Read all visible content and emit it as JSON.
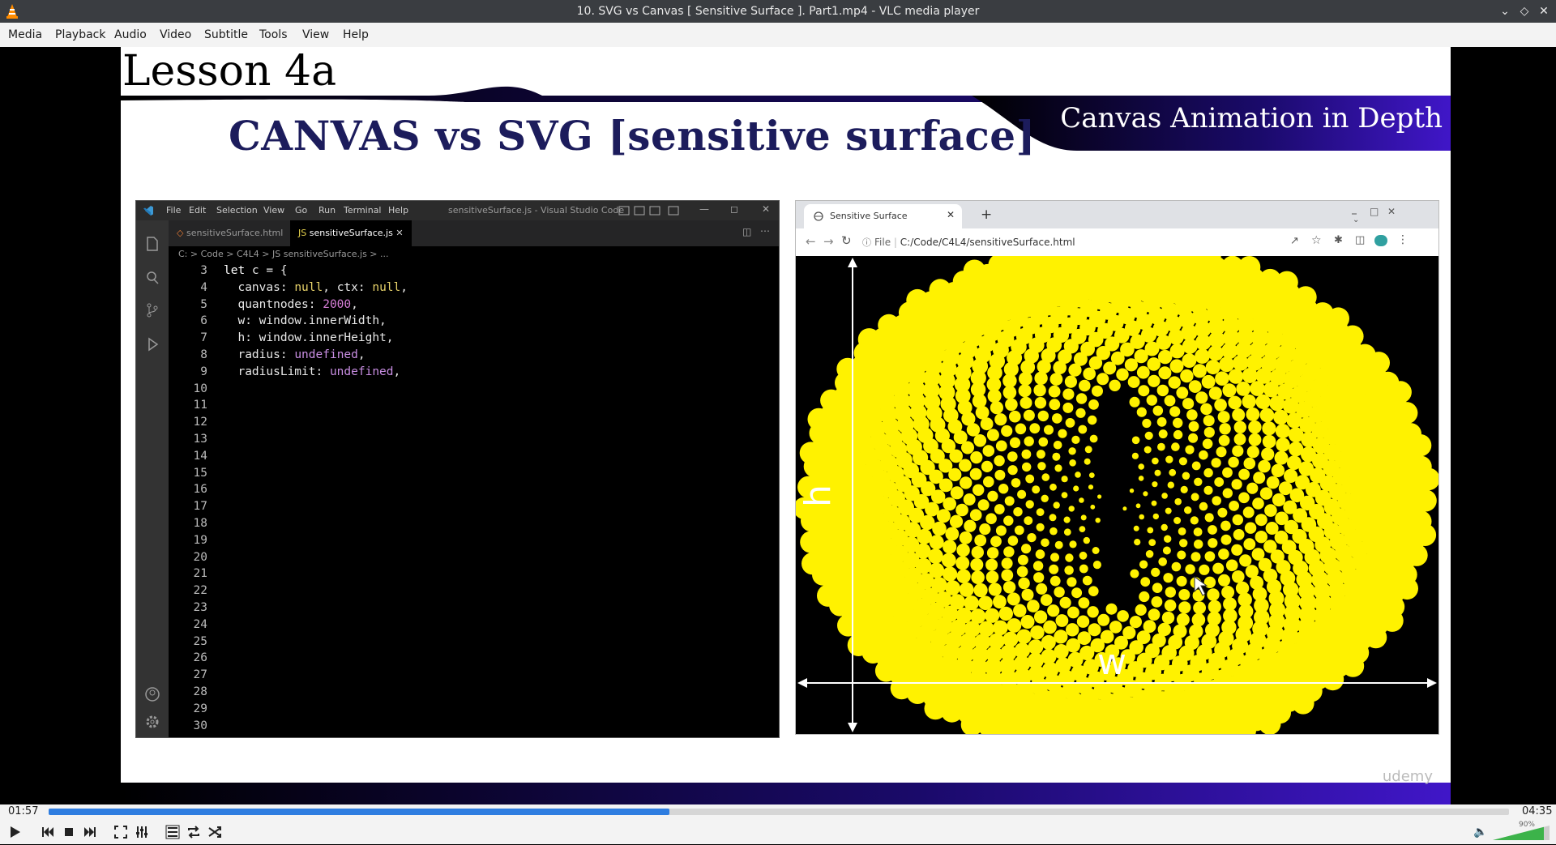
{
  "window": {
    "title": "10. SVG vs Canvas [ Sensitive Surface ]. Part1.mp4 - VLC media player"
  },
  "menu": [
    "Media",
    "Playback",
    "Audio",
    "Video",
    "Subtitle",
    "Tools",
    "View",
    "Help"
  ],
  "slide": {
    "lesson": "Lesson 4a",
    "course": "Canvas Animation in Depth",
    "heading": "CANVAS vs SVG [sensitive surface]",
    "watermark": "udemy"
  },
  "vscode": {
    "menu": [
      "File",
      "Edit",
      "Selection",
      "View",
      "Go",
      "Run",
      "Terminal",
      "Help"
    ],
    "title": "sensitiveSurface.js - Visual Studio Code",
    "tabs": [
      {
        "label": "sensitiveSurface.html",
        "active": false
      },
      {
        "label": "sensitiveSurface.js",
        "active": true
      }
    ],
    "breadcrumb": "C: > Code > C4L4 > JS sensitiveSurface.js > ...",
    "lines": [
      {
        "n": "3",
        "code": "let c = {"
      },
      {
        "n": "4",
        "code": "  canvas: null, ctx: null,"
      },
      {
        "n": "5",
        "code": "  quantnodes: 2000,"
      },
      {
        "n": "6",
        "code": "  w: window.innerWidth,"
      },
      {
        "n": "7",
        "code": "  h: window.innerHeight,"
      },
      {
        "n": "8",
        "code": "  radius: undefined,"
      },
      {
        "n": "9",
        "code": "  radiusLimit: undefined,"
      },
      {
        "n": "10",
        "code": ""
      },
      {
        "n": "11",
        "code": ""
      },
      {
        "n": "12",
        "code": ""
      },
      {
        "n": "13",
        "code": ""
      },
      {
        "n": "14",
        "code": ""
      },
      {
        "n": "15",
        "code": ""
      },
      {
        "n": "16",
        "code": ""
      },
      {
        "n": "17",
        "code": ""
      },
      {
        "n": "18",
        "code": ""
      },
      {
        "n": "19",
        "code": ""
      },
      {
        "n": "20",
        "code": ""
      },
      {
        "n": "21",
        "code": ""
      },
      {
        "n": "22",
        "code": ""
      },
      {
        "n": "23",
        "code": ""
      },
      {
        "n": "24",
        "code": ""
      },
      {
        "n": "25",
        "code": ""
      },
      {
        "n": "26",
        "code": ""
      },
      {
        "n": "27",
        "code": ""
      },
      {
        "n": "28",
        "code": ""
      },
      {
        "n": "29",
        "code": ""
      },
      {
        "n": "30",
        "code": ""
      }
    ]
  },
  "browser": {
    "tab_title": "Sensitive Surface",
    "url_prefix": "File",
    "url": "C:/Code/C4L4/sensitiveSurface.html",
    "label_h": "h",
    "label_w": "w",
    "dot_color": "#fff200"
  },
  "player": {
    "elapsed": "01:57",
    "total": "04:35",
    "progress": 0.425,
    "volume_text": "90%",
    "volume": 0.9,
    "accent": "#2e7de0"
  }
}
